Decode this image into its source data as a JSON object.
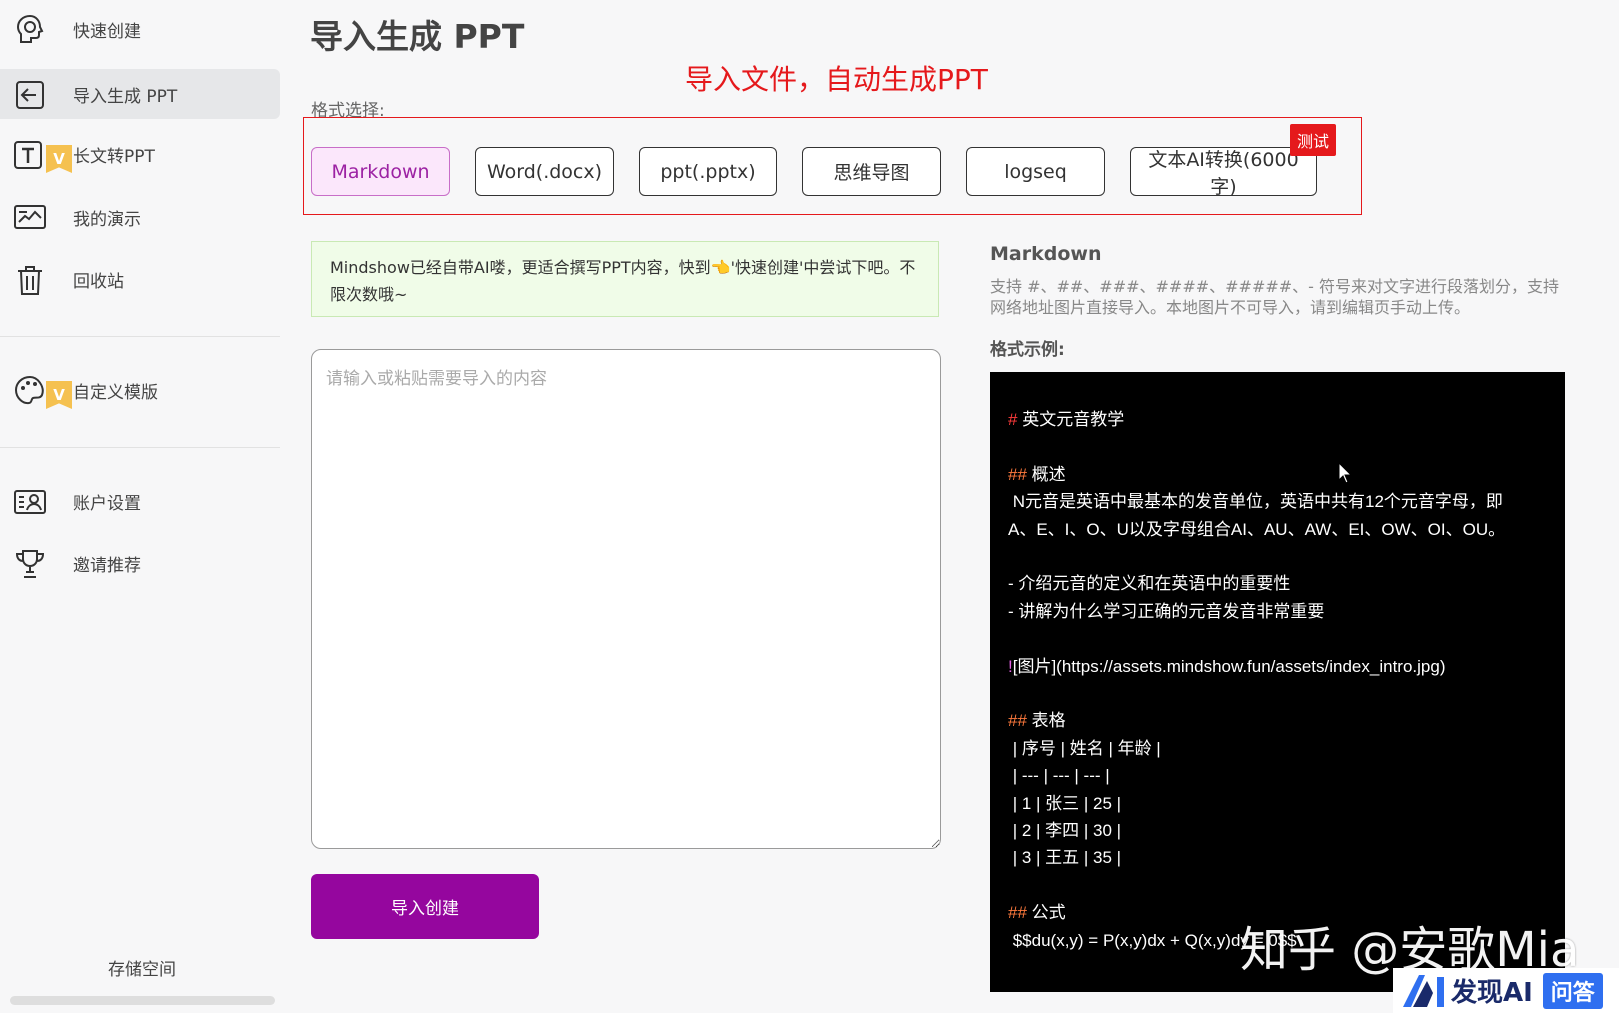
{
  "sidebar": {
    "items": [
      {
        "label": "快速创建",
        "icon": "brain-icon"
      },
      {
        "label": "导入生成 PPT",
        "icon": "import-icon",
        "active": true
      },
      {
        "label": "长文转PPT",
        "icon": "text-icon",
        "badge": "V"
      },
      {
        "label": "我的演示",
        "icon": "presentation-icon"
      },
      {
        "label": "回收站",
        "icon": "trash-icon"
      },
      {
        "label": "自定义模版",
        "icon": "palette-icon",
        "badge": "V"
      },
      {
        "label": "账户设置",
        "icon": "account-icon"
      },
      {
        "label": "邀请推荐",
        "icon": "trophy-icon"
      }
    ],
    "storage_label": "存储空间",
    "storage_used": 0
  },
  "main": {
    "title": "导入生成 PPT",
    "annotation": "导入文件，自动生成PPT",
    "format_label": "格式选择:",
    "formats": [
      "Markdown",
      "Word(.docx)",
      "ppt(.pptx)",
      "思维导图",
      "logseq",
      "文本AI转换(6000字)"
    ],
    "selected_format": "Markdown",
    "test_badge": "测试",
    "notice": "Mindshow已经自带AI喽，更适合撰写PPT内容，快到",
    "notice_hand": "👈",
    "notice_tail": "'快速创建'中尝试下吧。不限次数哦~",
    "input_placeholder": "请输入或粘贴需要导入的内容",
    "submit_label": "导入创建"
  },
  "panel": {
    "format_title": "Markdown",
    "format_desc": "支持 #、##、###、####、#####、- 符号来对文字进行段落划分，支持网络地址图片直接导入。本地图片不可导入，请到编辑页手动上传。",
    "example_title": "格式示例:",
    "example_lines": [
      {
        "prefix": "#",
        "text": " 英文元音教学",
        "kind": "h1"
      },
      {
        "prefix": "",
        "text": "",
        "kind": "blank"
      },
      {
        "prefix": "##",
        "text": " 概述",
        "kind": "h2"
      },
      {
        "prefix": "",
        "text": " N元音是英语中最基本的发音单位，英语中共有12个元音字母，即",
        "kind": "text"
      },
      {
        "prefix": "",
        "text": "A、E、I、O、U以及字母组合AI、AU、AW、EI、OW、OI、OU。",
        "kind": "text"
      },
      {
        "prefix": "",
        "text": "",
        "kind": "blank"
      },
      {
        "prefix": "",
        "text": "- 介绍元音的定义和在英语中的重要性",
        "kind": "text"
      },
      {
        "prefix": "",
        "text": "- 讲解为什么学习正确的元音发音非常重要",
        "kind": "text"
      },
      {
        "prefix": "",
        "text": "",
        "kind": "blank"
      },
      {
        "prefix": "!",
        "text": "[图片](https://assets.mindshow.fun/assets/index_intro.jpg)",
        "kind": "img"
      },
      {
        "prefix": "",
        "text": "",
        "kind": "blank"
      },
      {
        "prefix": "##",
        "text": " 表格",
        "kind": "h2"
      },
      {
        "prefix": "",
        "text": " | 序号 | 姓名 | 年龄 |",
        "kind": "text"
      },
      {
        "prefix": "",
        "text": " | --- | --- | --- |",
        "kind": "text"
      },
      {
        "prefix": "",
        "text": " | 1 | 张三 | 25 |",
        "kind": "text"
      },
      {
        "prefix": "",
        "text": " | 2 | 李四 | 30 |",
        "kind": "text"
      },
      {
        "prefix": "",
        "text": " | 3 | 王五 | 35 |",
        "kind": "text"
      },
      {
        "prefix": "",
        "text": "",
        "kind": "blank"
      },
      {
        "prefix": "##",
        "text": " 公式",
        "kind": "h2"
      },
      {
        "prefix": "",
        "text": " $$du(x,y) = P(x,y)dx + Q(x,y)dy = 0$$",
        "kind": "text"
      }
    ]
  },
  "watermark": "知乎 @安歌Mia",
  "brand": {
    "name": "发现AI",
    "tag": "问答"
  },
  "colors": {
    "accent": "#95069e",
    "annotation": "#e5191c",
    "code_bg": "#000000"
  }
}
